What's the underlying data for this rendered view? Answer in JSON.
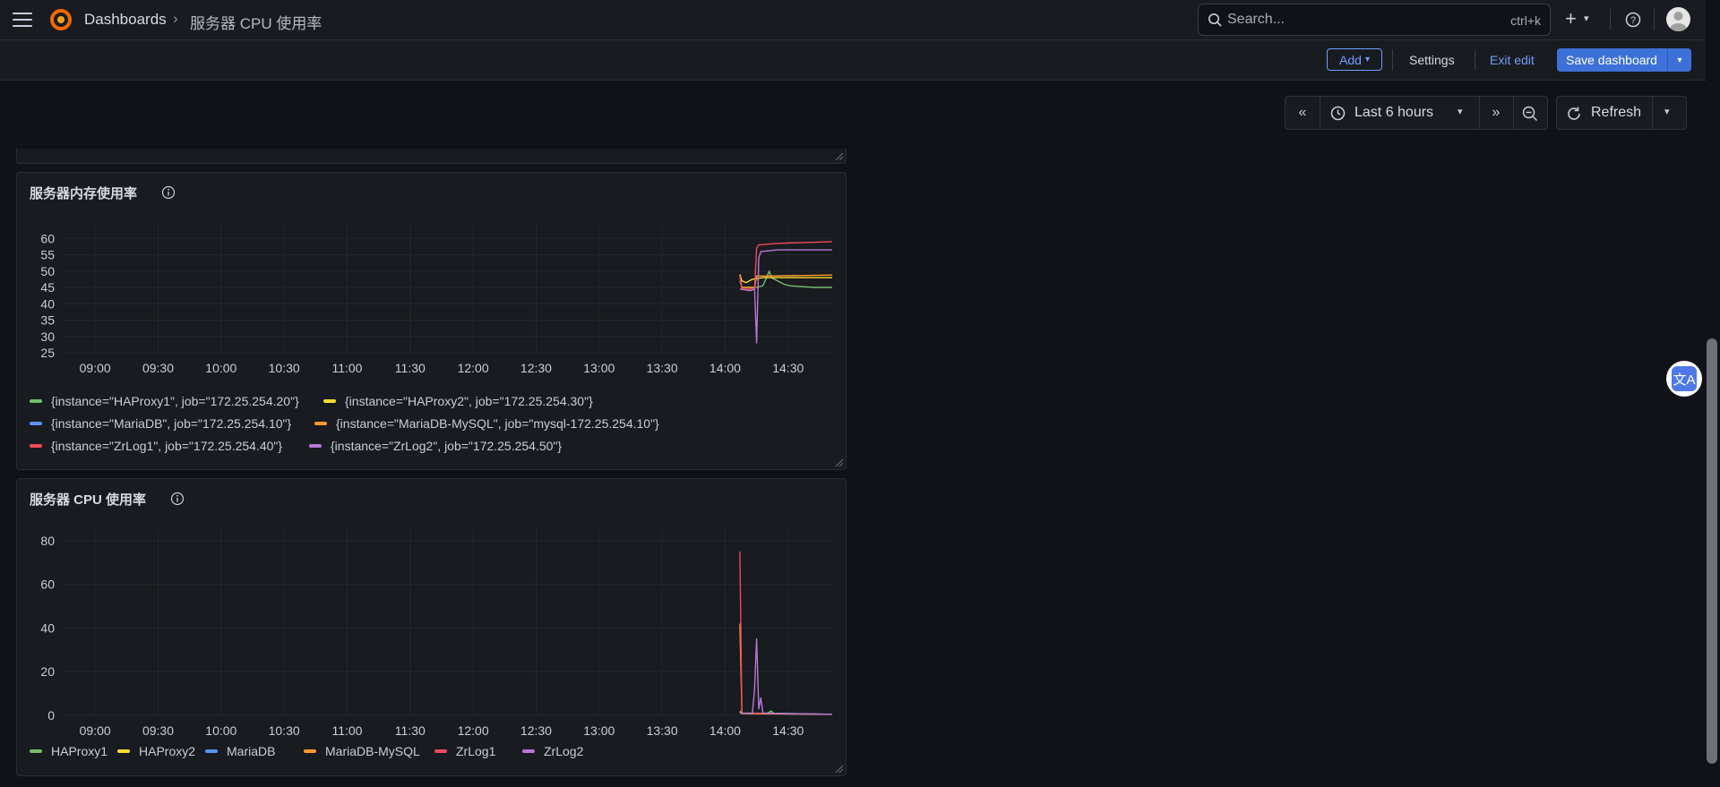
{
  "breadcrumb": {
    "root": "Dashboards",
    "current": "服务器 CPU 使用率"
  },
  "search": {
    "placeholder": "Search...",
    "shortcut": "ctrl+k"
  },
  "toolbar": {
    "add_label": "Add",
    "settings_label": "Settings",
    "exit_edit_label": "Exit edit",
    "save_label": "Save dashboard"
  },
  "timepicker": {
    "range_label": "Last 6 hours",
    "refresh_label": "Refresh"
  },
  "colors": {
    "accent": "#3d71d9",
    "link": "#6e9fff",
    "background": "#111217",
    "panel": "#181b1f"
  },
  "panels": {
    "memory": {
      "title": "服务器内存使用率",
      "legend": [
        {
          "label": "{instance=\"HAProxy1\", job=\"172.25.254.20\"}",
          "color": "#73bf69"
        },
        {
          "label": "{instance=\"HAProxy2\", job=\"172.25.254.30\"}",
          "color": "#fade2a"
        },
        {
          "label": "{instance=\"MariaDB\", job=\"172.25.254.10\"}",
          "color": "#5794f2"
        },
        {
          "label": "{instance=\"MariaDB-MySQL\", job=\"mysql-172.25.254.10\"}",
          "color": "#ff9830"
        },
        {
          "label": "{instance=\"ZrLog1\", job=\"172.25.254.40\"}",
          "color": "#f2495c"
        },
        {
          "label": "{instance=\"ZrLog2\", job=\"172.25.254.50\"}",
          "color": "#b877d9"
        }
      ]
    },
    "cpu": {
      "title": "服务器 CPU 使用率",
      "legend": [
        {
          "label": "HAProxy1",
          "color": "#73bf69"
        },
        {
          "label": "HAProxy2",
          "color": "#fade2a"
        },
        {
          "label": "MariaDB",
          "color": "#5794f2"
        },
        {
          "label": "MariaDB-MySQL",
          "color": "#ff9830"
        },
        {
          "label": "ZrLog1",
          "color": "#f2495c"
        },
        {
          "label": "ZrLog2",
          "color": "#b877d9"
        }
      ]
    }
  },
  "chart_data": [
    {
      "type": "line",
      "title": "服务器内存使用率",
      "xlabel": "",
      "ylabel": "",
      "x_ticks": [
        "09:00",
        "09:30",
        "10:00",
        "10:30",
        "11:00",
        "11:30",
        "12:00",
        "12:30",
        "13:00",
        "13:30",
        "14:00",
        "14:30"
      ],
      "xlim": [
        "08:45",
        "14:51"
      ],
      "y_ticks": [
        25,
        30,
        35,
        40,
        45,
        50,
        55,
        60
      ],
      "ylim": [
        25,
        62
      ],
      "grid": true,
      "legend_position": "bottom",
      "series": [
        {
          "name": "{instance=\"HAProxy1\", job=\"172.25.254.20\"}",
          "color": "#73bf69",
          "points": [
            [
              "14:07",
              47
            ],
            [
              "14:08",
              45
            ],
            [
              "14:15",
              45
            ],
            [
              "14:18",
              45.5
            ],
            [
              "14:21",
              50
            ],
            [
              "14:22",
              48
            ],
            [
              "14:25",
              47
            ],
            [
              "14:28",
              46
            ],
            [
              "14:31",
              45.5
            ],
            [
              "14:42",
              45
            ],
            [
              "14:51",
              45
            ]
          ]
        },
        {
          "name": "{instance=\"HAProxy2\", job=\"172.25.254.30\"}",
          "color": "#fade2a",
          "points": [
            [
              "14:07",
              49
            ],
            [
              "14:08",
              47
            ],
            [
              "14:10",
              46.5
            ],
            [
              "14:13",
              47.5
            ],
            [
              "14:18",
              48
            ],
            [
              "14:51",
              48
            ]
          ]
        },
        {
          "name": "{instance=\"MariaDB\", job=\"172.25.254.10\"}",
          "color": "#5794f2",
          "points": []
        },
        {
          "name": "{instance=\"MariaDB-MySQL\", job=\"mysql-172.25.254.10\"}",
          "color": "#ff9830",
          "points": [
            [
              "14:07",
              48.5
            ],
            [
              "14:08",
              45
            ],
            [
              "14:14",
              45
            ],
            [
              "14:15",
              48.5
            ],
            [
              "14:18",
              48.5
            ],
            [
              "14:51",
              48.8
            ]
          ]
        },
        {
          "name": "{instance=\"ZrLog1\", job=\"172.25.254.40\"}",
          "color": "#f2495c",
          "points": [
            [
              "14:07",
              48.5
            ],
            [
              "14:08",
              44.5
            ],
            [
              "14:14",
              44.5
            ],
            [
              "14:15",
              57
            ],
            [
              "14:16",
              58
            ],
            [
              "14:25",
              58.5
            ],
            [
              "14:51",
              59
            ]
          ]
        },
        {
          "name": "{instance=\"ZrLog2\", job=\"172.25.254.50\"}",
          "color": "#b877d9",
          "points": [
            [
              "14:07",
              44.5
            ],
            [
              "14:12",
              44
            ],
            [
              "14:14",
              44.5
            ],
            [
              "14:15",
              28
            ],
            [
              "14:16",
              54
            ],
            [
              "14:17",
              56
            ],
            [
              "14:25",
              56.5
            ],
            [
              "14:51",
              56.5
            ]
          ]
        }
      ]
    },
    {
      "type": "line",
      "title": "服务器 CPU 使用率",
      "xlabel": "",
      "ylabel": "",
      "x_ticks": [
        "09:00",
        "09:30",
        "10:00",
        "10:30",
        "11:00",
        "11:30",
        "12:00",
        "12:30",
        "13:00",
        "13:30",
        "14:00",
        "14:30"
      ],
      "xlim": [
        "08:45",
        "14:51"
      ],
      "y_ticks": [
        0,
        20,
        40,
        60,
        80
      ],
      "ylim": [
        0,
        82
      ],
      "grid": true,
      "legend_position": "bottom",
      "series": [
        {
          "name": "HAProxy1",
          "color": "#73bf69",
          "points": [
            [
              "14:07",
              2
            ],
            [
              "14:08",
              1
            ],
            [
              "14:20",
              1
            ],
            [
              "14:22",
              2
            ],
            [
              "14:23",
              1
            ],
            [
              "14:51",
              0.5
            ]
          ]
        },
        {
          "name": "HAProxy2",
          "color": "#fade2a",
          "points": [
            [
              "14:07",
              1.5
            ],
            [
              "14:08",
              0.8
            ],
            [
              "14:51",
              0.5
            ]
          ]
        },
        {
          "name": "MariaDB",
          "color": "#5794f2",
          "points": []
        },
        {
          "name": "MariaDB-MySQL",
          "color": "#ff9830",
          "points": [
            [
              "14:07",
              42
            ],
            [
              "14:08",
              1
            ],
            [
              "14:51",
              0.5
            ]
          ]
        },
        {
          "name": "ZrLog1",
          "color": "#f2495c",
          "points": [
            [
              "14:07",
              75
            ],
            [
              "14:08",
              1
            ],
            [
              "14:51",
              0.5
            ]
          ]
        },
        {
          "name": "ZrLog2",
          "color": "#b877d9",
          "points": [
            [
              "14:07",
              1
            ],
            [
              "14:13",
              1
            ],
            [
              "14:14",
              12
            ],
            [
              "14:15",
              35
            ],
            [
              "14:16",
              3
            ],
            [
              "14:17",
              8
            ],
            [
              "14:18",
              1
            ],
            [
              "14:51",
              0.5
            ]
          ]
        }
      ]
    }
  ]
}
